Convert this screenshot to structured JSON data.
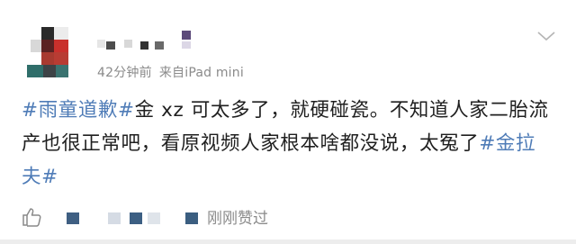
{
  "post": {
    "meta": {
      "time": "42分钟前",
      "source": "来自iPad mini"
    },
    "segments": [
      {
        "text": "#雨童道歉#",
        "tag": true
      },
      {
        "text": "金 xz 可太多了，就硬碰瓷。不知道人家二胎流产也很正常吧，看原视频人家根本啥都没说，太冤了",
        "tag": false
      },
      {
        "text": "#金拉夫#",
        "tag": true
      }
    ]
  },
  "actions": {
    "liked_label": "刚刚赞过"
  },
  "colors": {
    "hashtag": "#4f7cb7",
    "meta": "#8a8a8a",
    "text": "#1f1f1f"
  },
  "icons": [
    "chevron-down-icon",
    "thumbs-up-icon"
  ]
}
